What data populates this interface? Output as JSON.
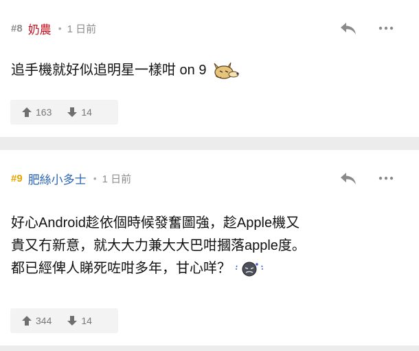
{
  "posts": [
    {
      "number": "#8",
      "username": "奶農",
      "separator": "•",
      "time": "1 日前",
      "body_text": "追手機就好似追明星一樣咁 on 9",
      "emoji": "fox-emoji",
      "upvotes": "163",
      "downvotes": "14",
      "colors": {
        "number": "#8c8c8c",
        "username": "#c0131f"
      }
    },
    {
      "number": "#9",
      "username": "肥絲小多士",
      "separator": "•",
      "time": "1 日前",
      "body_lines": [
        "好心Android趁依個時候發奮圖強，趁Apple機又",
        "貴又冇新意，就大大力兼大大巴咁摑落apple度。",
        "都已經俾人睇死咗咁多年，甘心咩？"
      ],
      "emoji": "sad-sweat-emoji",
      "upvotes": "344",
      "downvotes": "14",
      "colors": {
        "number": "#e6a500",
        "username": "#2a64b4"
      }
    }
  ],
  "icons": {
    "reply": "reply-icon",
    "more": "more-icon",
    "upvote": "thumb-up-arrow-icon",
    "downvote": "thumb-down-arrow-icon"
  }
}
